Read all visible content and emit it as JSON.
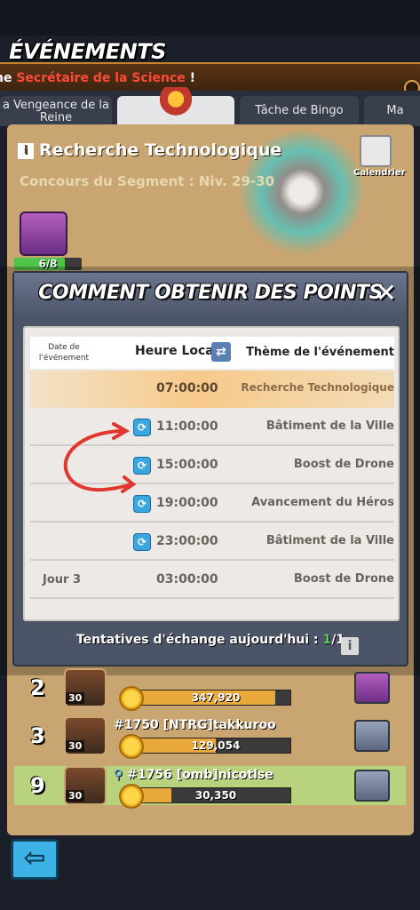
{
  "header": {
    "title": "ÉVÉNEMENTS"
  },
  "ticker": {
    "prefix": "he ",
    "highlight": "Secrétaire de la Science",
    "suffix": " !"
  },
  "tabs": [
    {
      "label": "a Vengeance de la Reine"
    },
    {
      "label": ""
    },
    {
      "label": "Tâche de Bingo"
    },
    {
      "label": "Ma"
    }
  ],
  "event": {
    "title": "Recherche Technologique",
    "subtitle": "Concours du Segment : Niv. 29-30",
    "calendar_label": "Calendrier",
    "chest_progress_label": "6/8",
    "chest_progress": 0.75
  },
  "modal": {
    "title": "COMMENT OBTENIR DES POINTS",
    "close_label": "✕",
    "columns": {
      "date": "Date de l'événement",
      "time": "Heure Locale",
      "theme": "Thème de l'événement"
    },
    "rows": [
      {
        "day": "",
        "time": "07:00:00",
        "theme": "Recherche Technologique",
        "icon": false,
        "highlight": true
      },
      {
        "day": "",
        "time": "11:00:00",
        "theme": "Bâtiment de la Ville",
        "icon": true,
        "highlight": false
      },
      {
        "day": "",
        "time": "15:00:00",
        "theme": "Boost de Drone",
        "icon": true,
        "highlight": false
      },
      {
        "day": "",
        "time": "19:00:00",
        "theme": "Avancement du Héros",
        "icon": true,
        "highlight": false
      },
      {
        "day": "",
        "time": "23:00:00",
        "theme": "Bâtiment de la Ville",
        "icon": true,
        "highlight": false
      },
      {
        "day": "Jour 3",
        "time": "03:00:00",
        "theme": "Boost de Drone",
        "icon": false,
        "highlight": false
      }
    ],
    "footer": {
      "label": "Tentatives d'échange aujourd'hui : ",
      "count": "1",
      "total": "/1"
    }
  },
  "leaderboard": [
    {
      "rank": "2",
      "level": "30",
      "name": "",
      "score": "347,920",
      "fill": 0.9
    },
    {
      "rank": "3",
      "level": "30",
      "name": "#1750 [NTRG]takkuroo",
      "score": "129,054",
      "fill": 0.5
    },
    {
      "rank": "9",
      "level": "30",
      "name": "#1756 [omb]nicotlse",
      "score": "30,350",
      "fill": 0.2
    }
  ],
  "icons": {
    "info": "info-icon",
    "calendar": "calendar-icon",
    "swap": "swap-icon",
    "refresh": "refresh-icon",
    "back": "back-arrow-icon",
    "close": "close-icon"
  },
  "colors": {
    "accent": "#3aa7e0",
    "highlight_row": "#f7c98a",
    "ticker_highlight": "#ff4a3a",
    "count": "#4bd64b"
  }
}
